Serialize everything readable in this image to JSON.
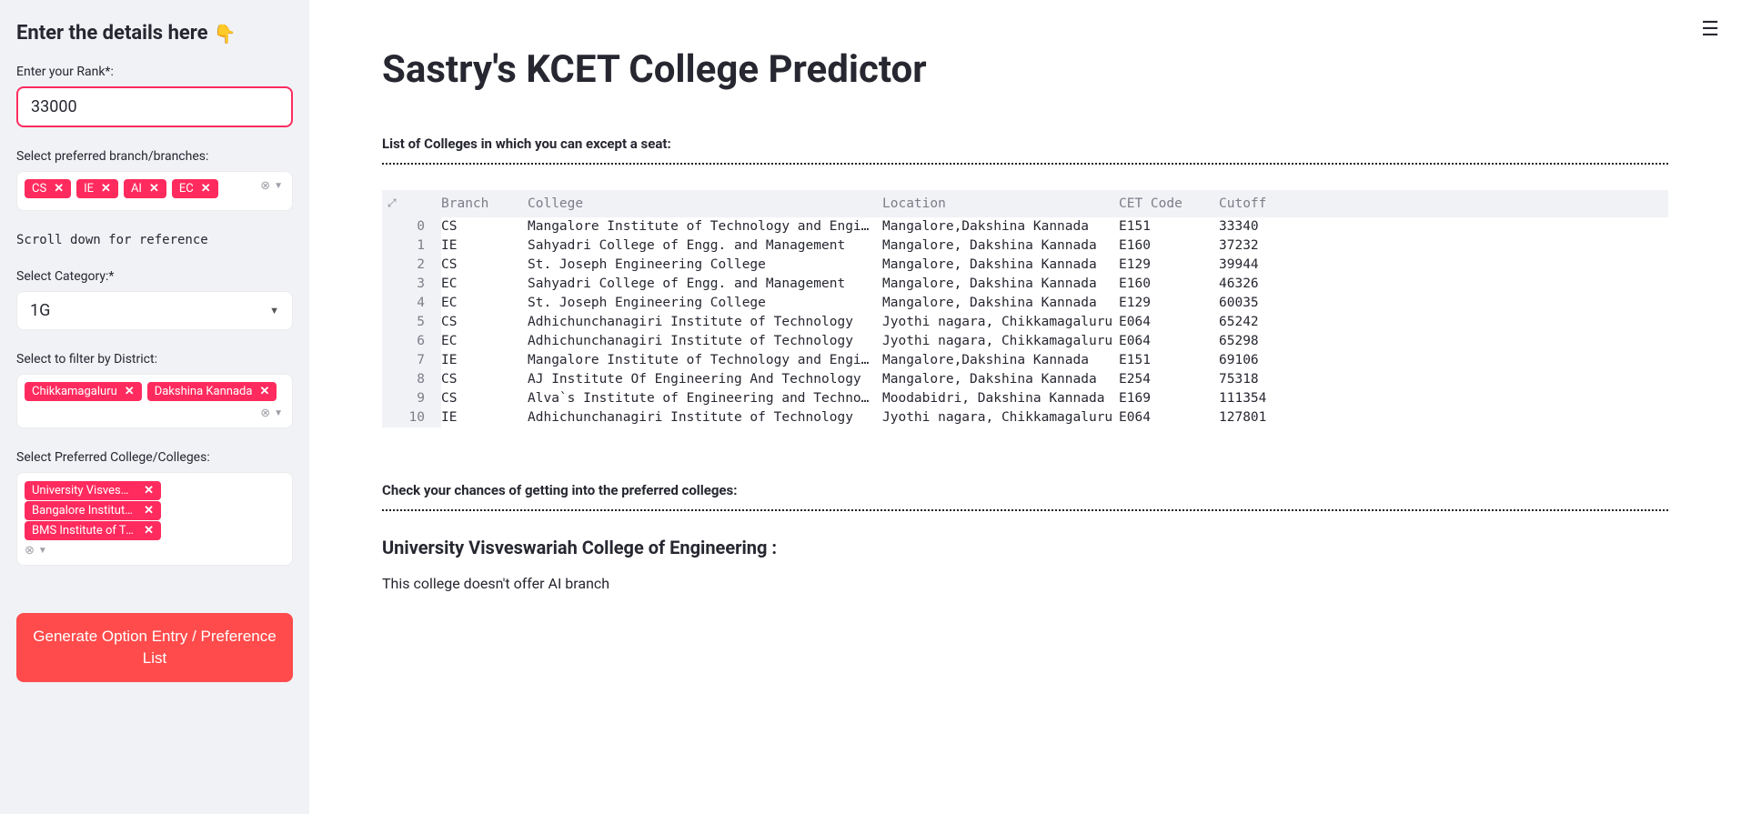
{
  "sidebar": {
    "heading": "Enter the details here",
    "rank_label": "Enter your Rank*:",
    "rank_value": "33000",
    "branch_label": "Select preferred branch/branches:",
    "branch_tags": [
      "CS",
      "IE",
      "AI",
      "EC"
    ],
    "scroll_hint": "Scroll down for reference",
    "category_label": "Select Category:*",
    "category_value": "1G",
    "district_label": "Select to filter by District:",
    "district_tags": [
      "Chikkamagaluru",
      "Dakshina Kannada"
    ],
    "college_label": "Select Preferred College/Colleges:",
    "college_tags": [
      "University Visveswari...",
      "Bangalore Institute of...",
      "BMS Institute of Tech..."
    ],
    "generate_btn": "Generate Option Entry / Preference List"
  },
  "main": {
    "title": "Sastry's KCET College Predictor",
    "list_heading": "List of Colleges in which you can except a seat:",
    "table": {
      "headers": {
        "branch": "Branch",
        "college": "College",
        "location": "Location",
        "cet": "CET Code",
        "cutoff": "Cutoff"
      },
      "rows": [
        {
          "idx": "0",
          "branch": "CS",
          "college": "Mangalore Institute of Technology and Enginee…",
          "location": "Mangalore,Dakshina Kannada",
          "cet": "E151",
          "cutoff": "33340"
        },
        {
          "idx": "1",
          "branch": "IE",
          "college": "Sahyadri College of Engg. and Management",
          "location": "Mangalore, Dakshina Kannada",
          "cet": "E160",
          "cutoff": "37232"
        },
        {
          "idx": "2",
          "branch": "CS",
          "college": "St. Joseph Engineering College",
          "location": "Mangalore, Dakshina Kannada",
          "cet": "E129",
          "cutoff": "39944"
        },
        {
          "idx": "3",
          "branch": "EC",
          "college": "Sahyadri College of Engg. and Management",
          "location": "Mangalore, Dakshina Kannada",
          "cet": "E160",
          "cutoff": "46326"
        },
        {
          "idx": "4",
          "branch": "EC",
          "college": "St. Joseph Engineering College",
          "location": "Mangalore, Dakshina Kannada",
          "cet": "E129",
          "cutoff": "60035"
        },
        {
          "idx": "5",
          "branch": "CS",
          "college": "Adhichunchanagiri Institute of Technology",
          "location": "Jyothi nagara, Chikkamagaluru",
          "cet": "E064",
          "cutoff": "65242"
        },
        {
          "idx": "6",
          "branch": "EC",
          "college": "Adhichunchanagiri Institute of Technology",
          "location": "Jyothi nagara, Chikkamagaluru",
          "cet": "E064",
          "cutoff": "65298"
        },
        {
          "idx": "7",
          "branch": "IE",
          "college": "Mangalore Institute of Technology and Enginee…",
          "location": "Mangalore,Dakshina Kannada",
          "cet": "E151",
          "cutoff": "69106"
        },
        {
          "idx": "8",
          "branch": "CS",
          "college": "AJ Institute Of Engineering And Technology",
          "location": "Mangalore, Dakshina Kannada",
          "cet": "E254",
          "cutoff": "75318"
        },
        {
          "idx": "9",
          "branch": "CS",
          "college": "Alva`s Institute of Engineering and Technology",
          "location": "Moodabidri, Dakshina Kannada",
          "cet": "E169",
          "cutoff": "111354"
        },
        {
          "idx": "10",
          "branch": "IE",
          "college": "Adhichunchanagiri Institute of Technology",
          "location": "Jyothi nagara, Chikkamagaluru",
          "cet": "E064",
          "cutoff": "127801"
        }
      ]
    },
    "chances_heading": "Check your chances of getting into the preferred colleges:",
    "subhead": "University Visveswariah College of Engineering :",
    "body": "This college doesn't offer AI branch"
  }
}
